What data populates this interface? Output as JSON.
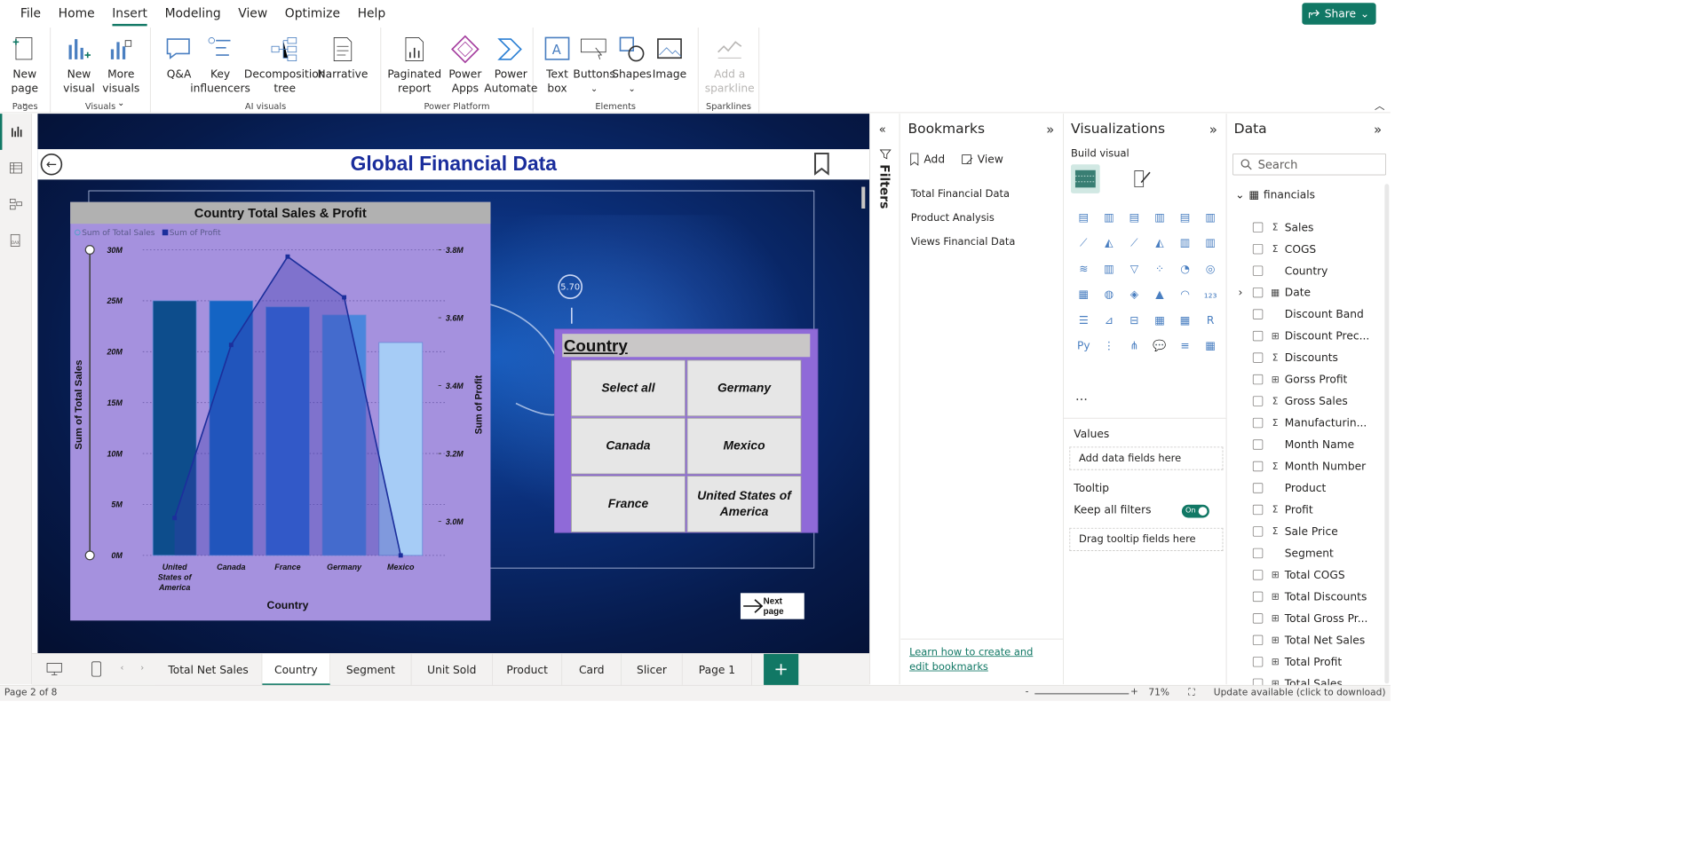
{
  "menu": [
    "File",
    "Home",
    "Insert",
    "Modeling",
    "View",
    "Optimize",
    "Help"
  ],
  "menu_active": "Insert",
  "share_label": "Share",
  "ribbon": {
    "groups": [
      {
        "label": "Pages",
        "buttons": [
          {
            "label": "New page",
            "dropdown": true,
            "icon": "new-page-icon"
          }
        ]
      },
      {
        "label": "Visuals",
        "buttons": [
          {
            "label": "New visual",
            "icon": "new-visual-icon"
          },
          {
            "label": "More visuals",
            "dropdown": true,
            "icon": "more-visuals-icon"
          }
        ]
      },
      {
        "label": "AI visuals",
        "buttons": [
          {
            "label": "Q&A",
            "icon": "qa-icon"
          },
          {
            "label": "Key influencers",
            "icon": "key-influencers-icon"
          },
          {
            "label": "Decomposition tree",
            "icon": "decomposition-tree-icon"
          },
          {
            "label": "Narrative",
            "icon": "narrative-icon"
          }
        ]
      },
      {
        "label": "Power Platform",
        "buttons": [
          {
            "label": "Paginated report",
            "icon": "paginated-report-icon"
          },
          {
            "label": "Power Apps",
            "icon": "power-apps-icon"
          },
          {
            "label": "Power Automate",
            "icon": "power-automate-icon"
          }
        ]
      },
      {
        "label": "Elements",
        "buttons": [
          {
            "label": "Text box",
            "icon": "text-box-icon"
          },
          {
            "label": "Buttons",
            "dropdown": true,
            "icon": "buttons-icon"
          },
          {
            "label": "Shapes",
            "dropdown": true,
            "icon": "shapes-icon"
          },
          {
            "label": "Image",
            "icon": "image-icon"
          }
        ]
      },
      {
        "label": "Sparklines",
        "buttons": [
          {
            "label": "Add a sparkline",
            "disabled": true,
            "icon": "sparkline-icon"
          }
        ]
      }
    ]
  },
  "report": {
    "title": "Global Financial Data",
    "callout_value": "5.70",
    "next_page_label": "Next page",
    "slicer": {
      "title": "Country",
      "options": [
        "Select all",
        "Germany",
        "Canada",
        "Mexico",
        "France",
        "United States of America"
      ]
    }
  },
  "chart_data": {
    "type": "bar",
    "title": "Country Total Sales & Profit",
    "legend": [
      "Sum of Total Sales",
      "Sum of Profit"
    ],
    "categories": [
      "United States of America",
      "Canada",
      "France",
      "Germany",
      "Mexico"
    ],
    "xlabel": "Country",
    "ylabel": "Sum of Total Sales",
    "y2label": "Sum of Profit",
    "ylim": [
      0,
      30000000
    ],
    "y2lim": [
      2.9,
      3.8
    ],
    "yticks": [
      "0M",
      "5M",
      "10M",
      "15M",
      "20M",
      "25M",
      "30M"
    ],
    "y2ticks": [
      "3.0M",
      "3.2M",
      "3.4M",
      "3.6M",
      "3.8M"
    ],
    "series": [
      {
        "name": "Sum of Total Sales",
        "type": "bar",
        "values": [
          25000000,
          25000000,
          24400000,
          23600000,
          20900000
        ]
      },
      {
        "name": "Sum of Profit",
        "type": "line",
        "values": [
          3.01,
          3.52,
          3.78,
          3.66,
          2.9
        ]
      }
    ],
    "bar_colors": [
      "#0d4d8c",
      "#1464c4",
      "#2e6ad6",
      "#4a86dd",
      "#a6ccf6"
    ]
  },
  "bookmarks": {
    "title": "Bookmarks",
    "add_label": "Add",
    "view_label": "View",
    "items": [
      "Total Financial Data",
      "Product Analysis",
      "Views Financial Data"
    ],
    "help_link": "Learn how to create and edit bookmarks"
  },
  "filters_label": "Filters",
  "visualizations": {
    "title": "Visualizations",
    "build_visual": "Build visual",
    "values_label": "Values",
    "values_placeholder": "Add data fields here",
    "tooltip_label": "Tooltip",
    "keep_filters_label": "Keep all filters",
    "toggle_label": "On",
    "tooltip_placeholder": "Drag tooltip fields here",
    "more": "···"
  },
  "data_pane": {
    "title": "Data",
    "search_placeholder": "Search",
    "table": "financials",
    "fields": [
      {
        "name": "Sales",
        "type": "Σ"
      },
      {
        "name": "COGS",
        "type": "Σ"
      },
      {
        "name": "Country",
        "type": ""
      },
      {
        "name": "Date",
        "type": "▦",
        "expand": true
      },
      {
        "name": "Discount Band",
        "type": ""
      },
      {
        "name": "Discount Prec...",
        "type": "⊞"
      },
      {
        "name": "Discounts",
        "type": "Σ"
      },
      {
        "name": "Gorss Profit",
        "type": "⊞"
      },
      {
        "name": "Gross Sales",
        "type": "Σ"
      },
      {
        "name": "Manufacturin...",
        "type": "Σ"
      },
      {
        "name": "Month Name",
        "type": ""
      },
      {
        "name": "Month Number",
        "type": "Σ"
      },
      {
        "name": "Product",
        "type": ""
      },
      {
        "name": "Profit",
        "type": "Σ"
      },
      {
        "name": "Sale Price",
        "type": "Σ"
      },
      {
        "name": "Segment",
        "type": ""
      },
      {
        "name": "Total COGS",
        "type": "⊞"
      },
      {
        "name": "Total Discounts",
        "type": "⊞"
      },
      {
        "name": "Total Gross Pr...",
        "type": "⊞"
      },
      {
        "name": "Total Net Sales",
        "type": "⊞"
      },
      {
        "name": "Total Profit",
        "type": "⊞"
      },
      {
        "name": "Total Sales",
        "type": "⊞"
      }
    ]
  },
  "page_tabs": [
    "Total Net Sales",
    "Country",
    "Segment",
    "Unit Sold",
    "Product",
    "Card",
    "Slicer",
    "Page 1"
  ],
  "active_tab": "Country",
  "status": {
    "page": "Page 2 of 8",
    "zoom": "71%",
    "update": "Update available (click to download)"
  }
}
